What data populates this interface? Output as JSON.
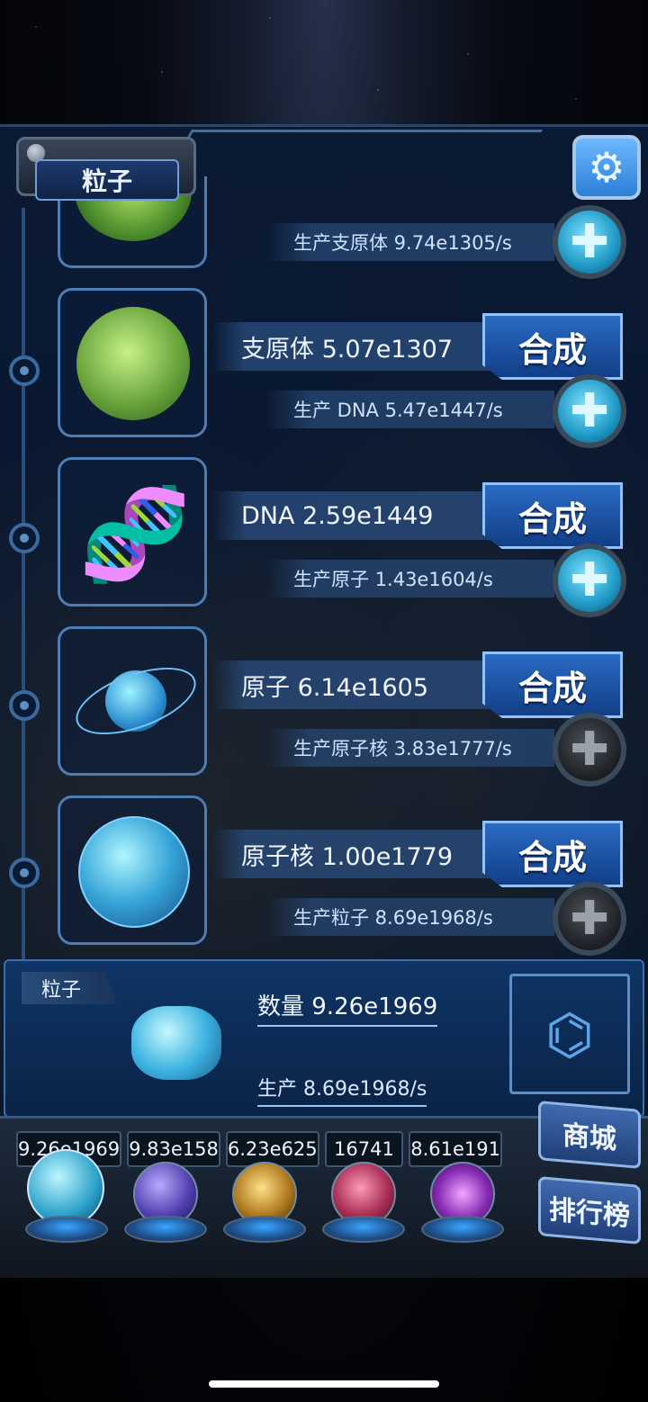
{
  "header": {
    "title": "粒子",
    "settings_icon": "gear-icon"
  },
  "rows": [
    {
      "item": "mycoplasma-top",
      "produce_label": "生产支原体 9.74e1305/s",
      "plus_active": true
    },
    {
      "item": "mycoplasma",
      "name_label": "支原体 5.07e1307",
      "synth_label": "合成",
      "produce_label": "生产 DNA 5.47e1447/s",
      "plus_active": true
    },
    {
      "item": "dna",
      "name_label": "DNA 2.59e1449",
      "synth_label": "合成",
      "produce_label": "生产原子 1.43e1604/s",
      "plus_active": true
    },
    {
      "item": "atom",
      "name_label": "原子 6.14e1605",
      "synth_label": "合成",
      "produce_label": "生产原子核 3.83e1777/s",
      "plus_active": false
    },
    {
      "item": "nucleus",
      "name_label": "原子核 1.00e1779",
      "synth_label": "合成",
      "produce_label": "生产粒子 8.69e1968/s",
      "plus_active": false
    }
  ],
  "info": {
    "tag": "粒子",
    "count_label": "数量 9.26e1969",
    "rate_label": "生产 8.69e1968/s"
  },
  "resources": [
    "9.26e1969",
    "9.83e158",
    "6.23e625",
    "16741",
    "8.61e191"
  ],
  "dock": {
    "shop_label": "商城",
    "rank_label": "排行榜"
  },
  "colors": {
    "accent": "#2a6bc4",
    "panel": "#0a1830",
    "plus_active": "#1f98c4"
  }
}
